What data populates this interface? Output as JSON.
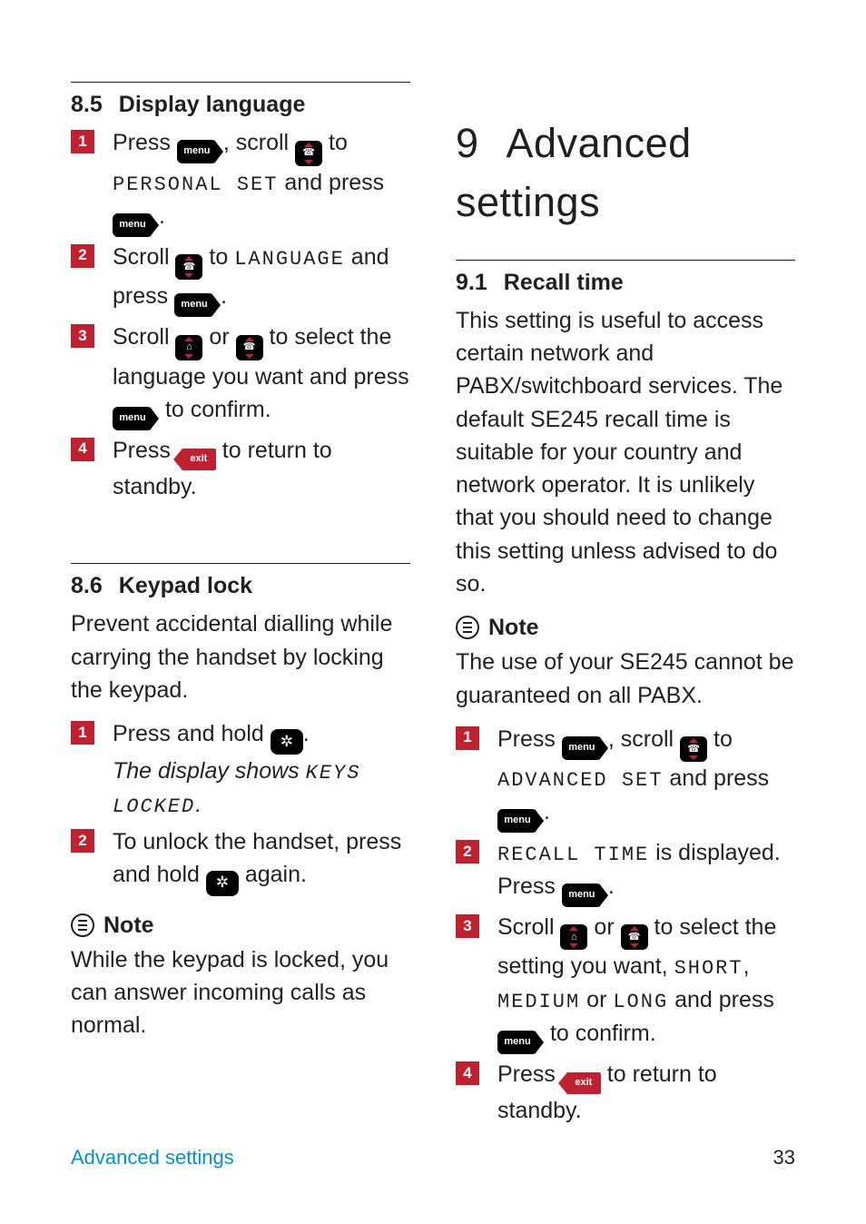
{
  "left": {
    "s85": {
      "num": "8.5",
      "title": "Display language",
      "steps": [
        {
          "pre": "Press ",
          "key1": "menu",
          "mid1": ", scroll ",
          "key2": "scroll-down",
          "mid2": " to ",
          "lcd": "PERSONAL SET",
          "mid3": " and press ",
          "key3": "menu",
          "post": "."
        },
        {
          "pre": "Scroll ",
          "key1": "scroll-down",
          "mid1": " to ",
          "lcd": "LANGUAGE",
          "mid2": " and press ",
          "key2": "menu",
          "post": "."
        },
        {
          "pre": "Scroll ",
          "key1": "scroll-up",
          "mid1": " or ",
          "key2": "scroll-down",
          "mid2": " to select the language you want and press ",
          "key3": "menu",
          "post": " to confirm."
        },
        {
          "pre": "Press ",
          "key1": "exit",
          "post": " to return to standby."
        }
      ]
    },
    "s86": {
      "num": "8.6",
      "title": "Keypad lock",
      "intro": "Prevent accidental dialling while carrying the handset by locking the keypad.",
      "steps": [
        {
          "pre": "Press and hold ",
          "key1": "star",
          "post": ".",
          "italic_pre": "The display shows ",
          "lcd": "KEYS LOCKED",
          "italic_post": "."
        },
        {
          "pre": "To unlock the handset, press and hold ",
          "key1": "star",
          "post": " again."
        }
      ],
      "note_label": "Note",
      "note": "While the keypad is locked, you can answer incoming calls as normal."
    }
  },
  "right": {
    "chapter_num": "9",
    "chapter_title": "Advanced settings",
    "s91": {
      "num": "9.1",
      "title": "Recall time",
      "intro": "This setting is useful to access certain network and PABX/switchboard services. The default SE245 recall time is suitable for your country and network operator. It is unlikely that you should need to change this setting unless advised to do so.",
      "note_label": "Note",
      "note": "The use of your SE245 cannot be guaranteed on all PABX.",
      "steps": [
        {
          "pre": "Press ",
          "key1": "menu",
          "mid1": ", scroll ",
          "key2": "scroll-down",
          "mid2": " to ",
          "lcd": "ADVANCED SET",
          "mid3": " and press ",
          "key3": "menu",
          "post": "."
        },
        {
          "lcd": "RECALL TIME",
          "mid1": " is displayed. Press ",
          "key1": "menu",
          "post": "."
        },
        {
          "pre": "Scroll ",
          "key1": "scroll-up",
          "mid1": " or ",
          "key2": "scroll-down",
          "mid2": " to select the setting you want, ",
          "lcd1": "SHORT",
          "sep1": ", ",
          "lcd2": "MEDIUM",
          "sep2": " or ",
          "lcd3": "LONG",
          "mid3": " and press ",
          "key3": "menu",
          "post": " to confirm."
        },
        {
          "pre": "Press ",
          "key1": "exit",
          "post": " to return to standby."
        }
      ]
    }
  },
  "footer": {
    "title": "Advanced settings",
    "page": "33"
  },
  "keys": {
    "menu": "menu",
    "exit": "exit"
  }
}
